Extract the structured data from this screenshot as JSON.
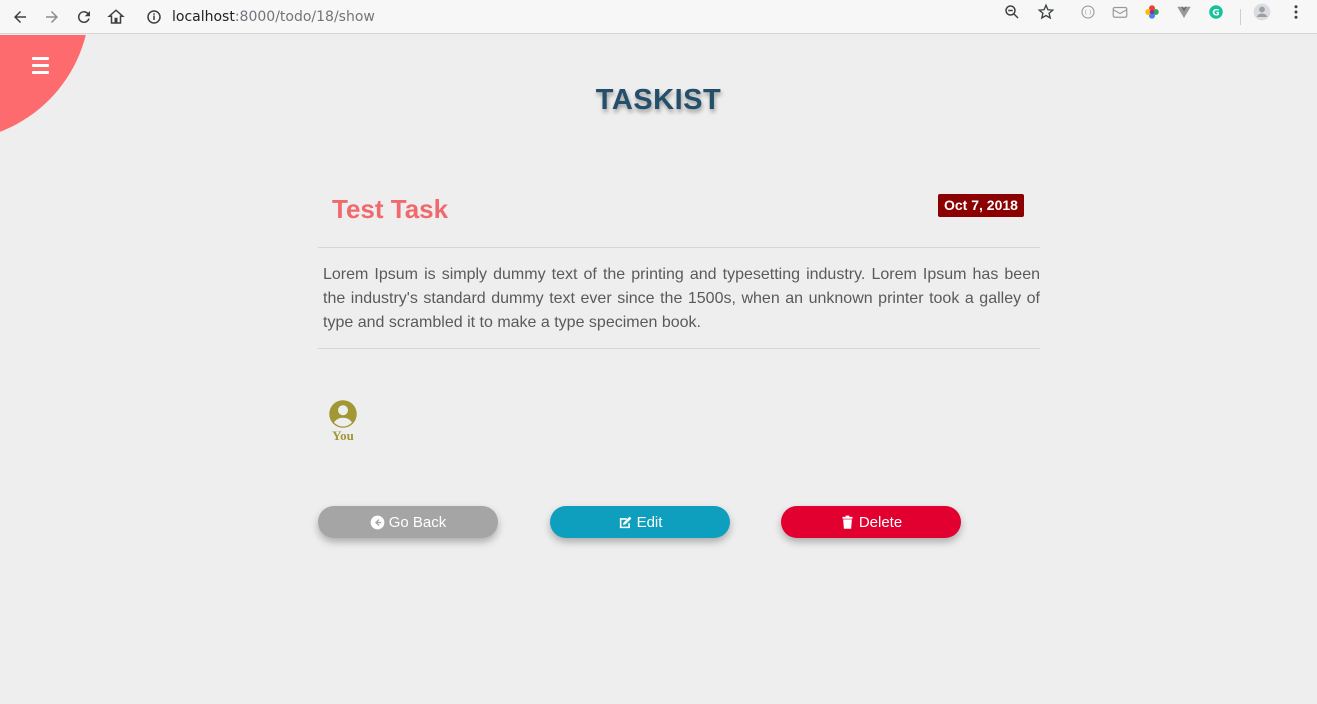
{
  "browser": {
    "url_host": "localhost",
    "url_path": ":8000/todo/18/show",
    "icons": [
      "back-arrow-icon",
      "forward-arrow-icon",
      "reload-icon",
      "home-icon",
      "info-icon",
      "zoom-icon",
      "star-icon",
      "extension-icon",
      "mail-icon",
      "color-wheel-icon",
      "vue-devtools-icon",
      "grammarly-icon",
      "profile-icon",
      "menu-dots-icon"
    ]
  },
  "app": {
    "brand": "TASKIST",
    "accent_color": "#fe6b6e"
  },
  "task": {
    "title": "Test Task",
    "date": "Oct 7, 2018",
    "description": "Lorem Ipsum is simply dummy text of the printing and typesetting industry. Lorem Ipsum has been the industry's standard dummy text ever since the 1500s, when an unknown printer took a galley of type and scrambled it to make a type specimen book.",
    "owner_label": "You"
  },
  "actions": {
    "back_label": "Go Back",
    "edit_label": "Edit",
    "delete_label": "Delete"
  }
}
